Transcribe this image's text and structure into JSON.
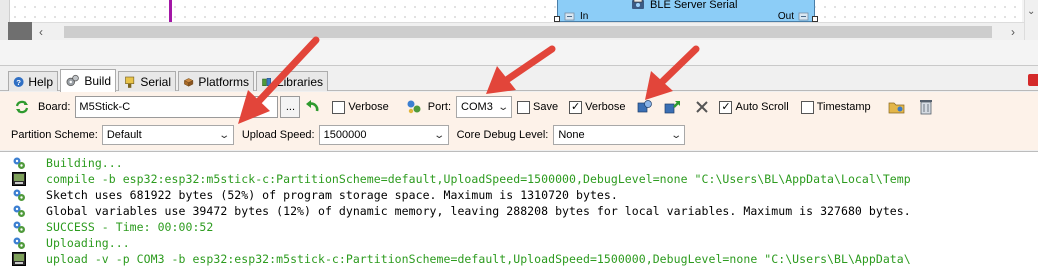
{
  "canvas": {
    "node_title": "BLE Server Serial",
    "pin_in": "In",
    "pin_out": "Out"
  },
  "tabs": [
    {
      "label": "Help",
      "icon": "help-icon"
    },
    {
      "label": "Build",
      "icon": "build-icon",
      "active": true
    },
    {
      "label": "Serial",
      "icon": "serial-icon"
    },
    {
      "label": "Platforms",
      "icon": "platforms-icon"
    },
    {
      "label": "Libraries",
      "icon": "libraries-icon"
    }
  ],
  "build": {
    "board_label": "Board:",
    "board_value": "M5Stick-C",
    "browse_label": "...",
    "verbose_label": "Verbose",
    "verbose_checked": false,
    "port_label": "Port:",
    "port_value": "COM3",
    "save_label": "Save",
    "save_checked": false,
    "verbose2_label": "Verbose",
    "verbose2_checked": true,
    "autoscroll_label": "Auto Scroll",
    "autoscroll_checked": true,
    "timestamp_label": "Timestamp",
    "timestamp_checked": false,
    "partition_label": "Partition Scheme:",
    "partition_value": "Default",
    "upload_speed_label": "Upload Speed:",
    "upload_speed_value": "1500000",
    "core_debug_label": "Core Debug Level:",
    "core_debug_value": "None"
  },
  "console": [
    {
      "type": "info",
      "color": "#2c9b1e",
      "text": "Building..."
    },
    {
      "type": "command",
      "color": "#2c9b1e",
      "text": "compile -b esp32:esp32:m5stick-c:PartitionScheme=default,UploadSpeed=1500000,DebugLevel=none \"C:\\Users\\BL\\AppData\\Local\\Temp"
    },
    {
      "type": "info",
      "color": "#000000",
      "text": "Sketch uses 681922 bytes (52%) of program storage space. Maximum is 1310720 bytes."
    },
    {
      "type": "info",
      "color": "#000000",
      "text": "Global variables use 39472 bytes (12%) of dynamic memory, leaving 288208 bytes for local variables. Maximum is 327680 bytes."
    },
    {
      "type": "info",
      "color": "#2c9b1e",
      "text": "SUCCESS - Time: 00:00:52"
    },
    {
      "type": "info",
      "color": "#2c9b1e",
      "text": "Uploading..."
    },
    {
      "type": "command",
      "color": "#2c9b1e",
      "text": "upload -v -p COM3 -b esp32:esp32:m5stick-c:PartitionScheme=default,UploadSpeed=1500000,DebugLevel=none \"C:\\Users\\BL\\AppData\\"
    }
  ],
  "colors": {
    "panel_bg": "#fdf2e9",
    "node_fill": "#8ccdf7",
    "wire": "#a316a6",
    "arrow": "#e2453a",
    "console_green": "#2c9b1e"
  }
}
